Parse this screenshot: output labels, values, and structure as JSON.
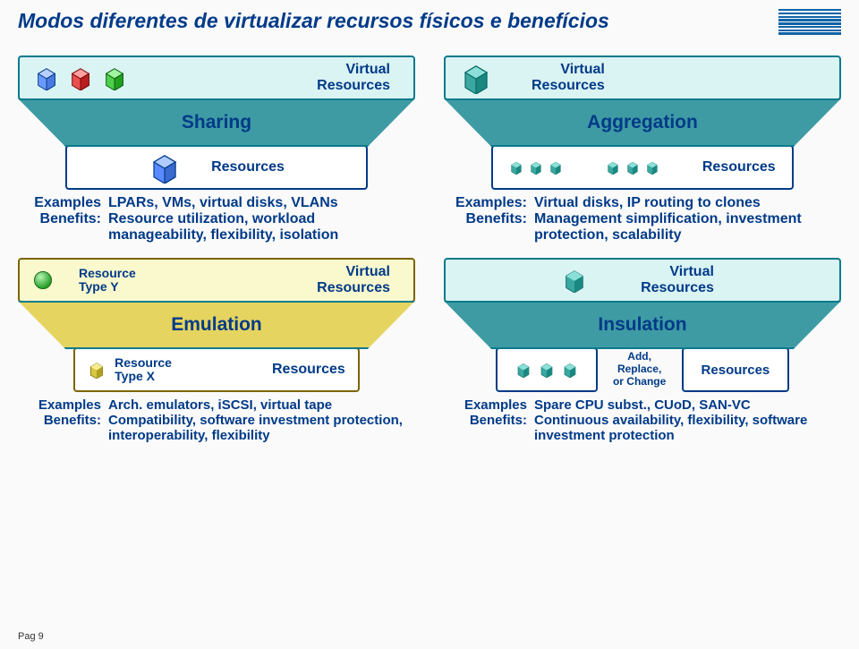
{
  "title": "Modos diferentes de virtualizar recursos físicos e benefícios",
  "page_number": "Pag 9",
  "sharing": {
    "top_label": "Virtual\nResources",
    "name": "Sharing",
    "bottom_label": "Resources",
    "examples_label": "Examples",
    "examples": "LPARs, VMs, virtual disks, VLANs",
    "benefits_label": "Benefits:",
    "benefits": "Resource utilization, workload manageability, flexibility, isolation"
  },
  "aggregation": {
    "top_label": "Virtual\nResources",
    "name": "Aggregation",
    "bottom_label": "Resources",
    "examples_label": "Examples:",
    "examples": "Virtual disks, IP routing to clones",
    "benefits_label": "Benefits:",
    "benefits": "Management simplification, investment protection, scalability"
  },
  "emulation": {
    "top_left_label": "Resource\nType Y",
    "top_right_label": "Virtual\nResources",
    "name": "Emulation",
    "bottom_left_label": "Resource\nType X",
    "bottom_right_label": "Resources",
    "examples_label": "Examples",
    "examples": "Arch. emulators, iSCSI, virtual tape",
    "benefits_label": "Benefits:",
    "benefits": "Compatibility, software investment protection, interoperability, flexibility"
  },
  "insulation": {
    "top_label": "Virtual\nResources",
    "name": "Insulation",
    "bottom_mid_label": "Add, Replace,\nor Change",
    "bottom_label": "Resources",
    "examples_label": "Examples",
    "examples": "Spare CPU subst., CUoD, SAN-VC",
    "benefits_label": "Benefits:",
    "benefits": "Continuous availability, flexibility, software investment protection"
  }
}
